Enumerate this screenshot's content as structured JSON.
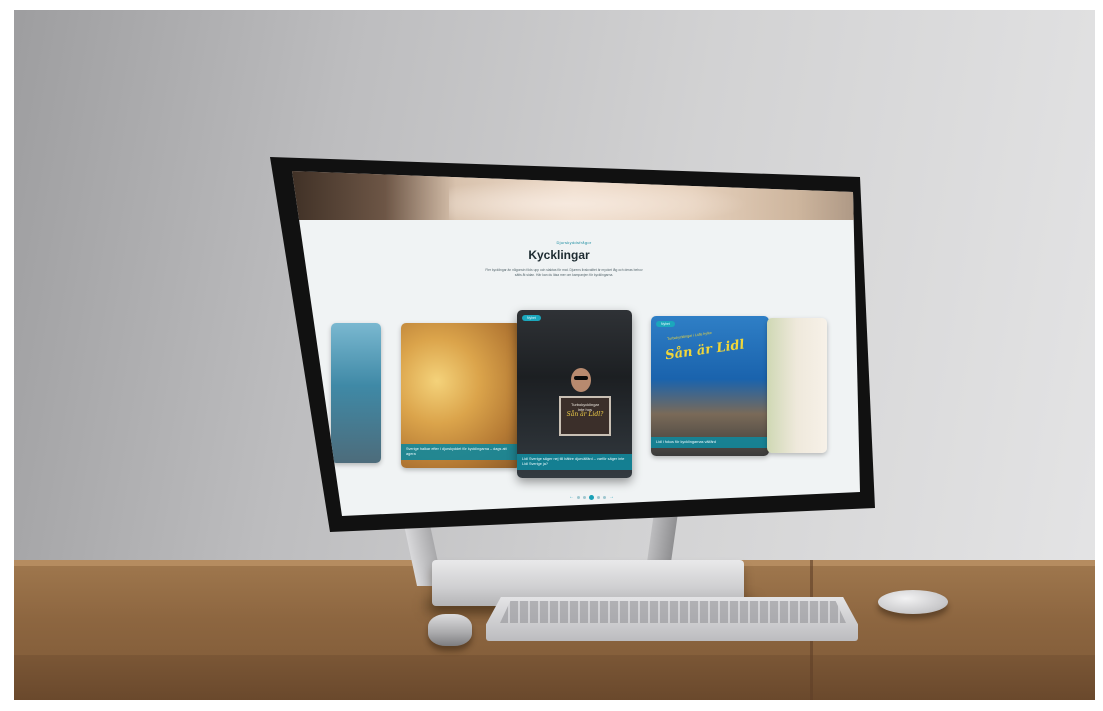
{
  "page": {
    "eyebrow": "Djurskyddsfrågor",
    "title": "Kycklingar",
    "intro": "Fler kycklingar än någonsin föds upp och slaktas för mat. Djurens livskvalitet är mycket låg och deras behov sätts åt sidan. Här kan du läsa mer om kampanjen för kycklingarna."
  },
  "cards": [
    {
      "tag": "",
      "caption": ""
    },
    {
      "tag": "",
      "caption": "Sverige halkar efter i djurskyddet för kycklingarna – dags att agera"
    },
    {
      "tag": "Nyhet",
      "caption": "Lidl Sverige säger nej till bättre djurvälfärd – varför säger inte Lidl Sverige ja?",
      "sign_lines": [
        "Turbokycklingar",
        "inte hos"
      ],
      "sign_script": "Sån är Lidl?"
    },
    {
      "tag": "Nyhet",
      "caption": "Lidl i fokus för kycklingarnas välfärd",
      "banner_small": "Turbokycklingar i Lidls hyllor",
      "banner_text": "Sån är Lidl"
    },
    {
      "tag": "",
      "caption": ""
    }
  ],
  "pager": {
    "prev": "←",
    "next": "→",
    "count": 5,
    "active_index": 2
  },
  "colors": {
    "accent": "#1aa0b6",
    "caption_bg": "#12879b",
    "title": "#1d2b31",
    "screen_bg": "#f0f3f4"
  }
}
